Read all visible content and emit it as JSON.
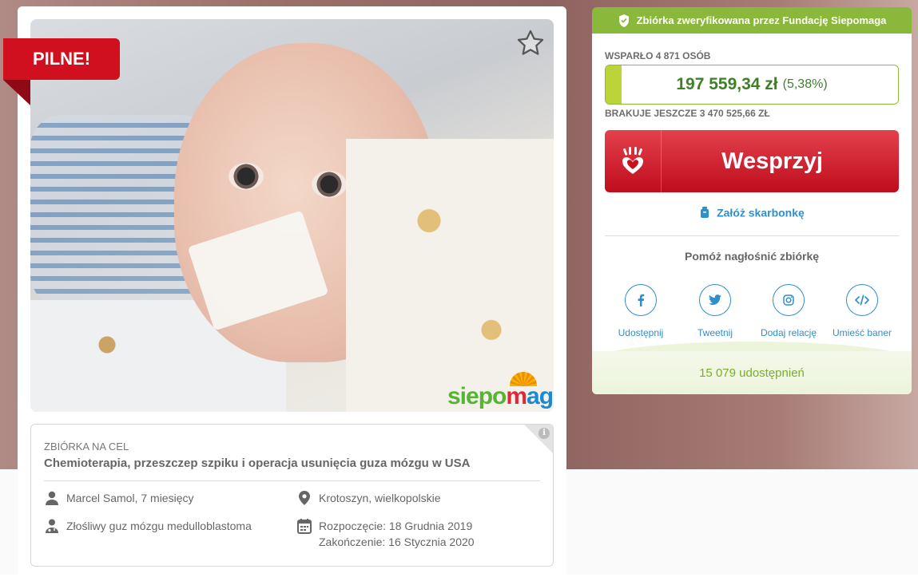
{
  "badge": {
    "label": "PILNE!"
  },
  "photo": {
    "logo_parts": [
      "siepo",
      "m",
      "aga"
    ]
  },
  "goal_card": {
    "label": "ZBIÓRKA NA CEL",
    "title": "Chemioterapia, przeszczep szpiku i operacja usunięcia guza mózgu w USA",
    "person": "Marcel Samol, 7 miesięcy",
    "location": "Krotoszyn, wielkopolskie",
    "diagnosis": "Złośliwy guz mózgu medulloblastoma",
    "start": "Rozpoczęcie: 18 Grudnia 2019",
    "end": "Zakończenie: 16 Stycznia 2020"
  },
  "verification": {
    "text": "Zbiórka zweryfikowana przez Fundację Siepomaga",
    "color": "#8ab83a"
  },
  "fundraising": {
    "supporters": "WSPARŁO 4 871 OSÓB",
    "amount": "197 559,34 zł",
    "percent": "(5,38%)",
    "progress_fraction": 0.0538,
    "missing": "BRAKUJE JESZCZE 3 470 525,66 ZŁ"
  },
  "donate": {
    "label": "Wesprzyj",
    "color": "#c8101f"
  },
  "piggy_bank": {
    "label": "Załóż skarbonkę"
  },
  "promote": {
    "title": "Pomóż nagłośnić zbiórkę",
    "actions": [
      {
        "icon": "facebook-icon",
        "label": "Udostępnij"
      },
      {
        "icon": "twitter-icon",
        "label": "Tweetnij"
      },
      {
        "icon": "instagram-icon",
        "label": "Dodaj relację"
      },
      {
        "icon": "code-icon",
        "label": "Umieść baner"
      }
    ]
  },
  "shares": {
    "text": "15 079 udostępnień"
  }
}
